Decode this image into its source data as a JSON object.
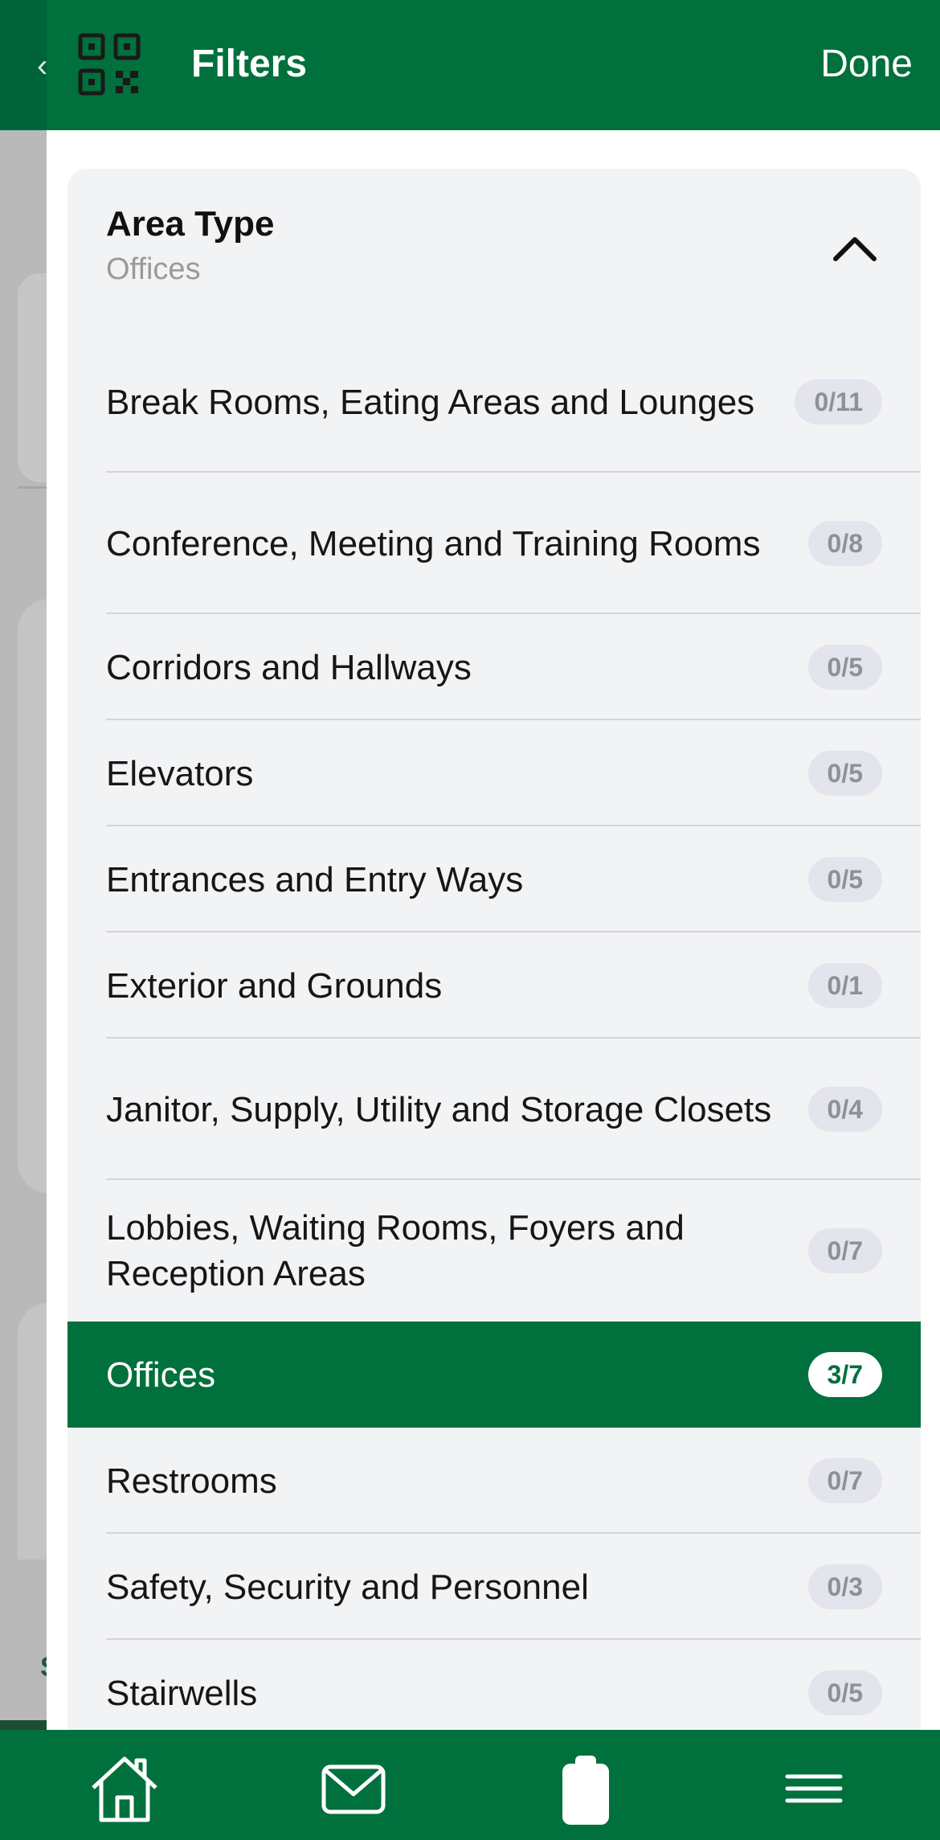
{
  "background": {
    "back_glyph": "‹",
    "letter": "S"
  },
  "header": {
    "title": "Filters",
    "done_label": "Done",
    "qr_icon": "qr-code-icon"
  },
  "section": {
    "title": "Area Type",
    "selected_value": "Offices",
    "chevron_icon": "chevron-up-icon"
  },
  "areas": [
    {
      "label": "Break Rooms, Eating Areas and Lounges",
      "count": "0/11",
      "selected": false
    },
    {
      "label": "Conference, Meeting and Training Rooms",
      "count": "0/8",
      "selected": false
    },
    {
      "label": "Corridors and Hallways",
      "count": "0/5",
      "selected": false
    },
    {
      "label": "Elevators",
      "count": "0/5",
      "selected": false
    },
    {
      "label": "Entrances and Entry Ways",
      "count": "0/5",
      "selected": false
    },
    {
      "label": "Exterior and Grounds",
      "count": "0/1",
      "selected": false
    },
    {
      "label": "Janitor, Supply, Utility and Storage Closets",
      "count": "0/4",
      "selected": false
    },
    {
      "label": "Lobbies, Waiting Rooms, Foyers and Reception Areas",
      "count": "0/7",
      "selected": false
    },
    {
      "label": "Offices",
      "count": "3/7",
      "selected": true
    },
    {
      "label": "Restrooms",
      "count": "0/7",
      "selected": false
    },
    {
      "label": "Safety, Security and Personnel",
      "count": "0/3",
      "selected": false
    },
    {
      "label": "Stairwells",
      "count": "0/5",
      "selected": false
    }
  ],
  "bottom_nav": [
    {
      "icon": "home-icon"
    },
    {
      "icon": "mail-icon"
    },
    {
      "icon": "clipboard-icon"
    },
    {
      "icon": "menu-icon"
    }
  ],
  "colors": {
    "brand": "#00703D",
    "panel": "#F2F3F5",
    "badge": "#E3E4EC"
  }
}
